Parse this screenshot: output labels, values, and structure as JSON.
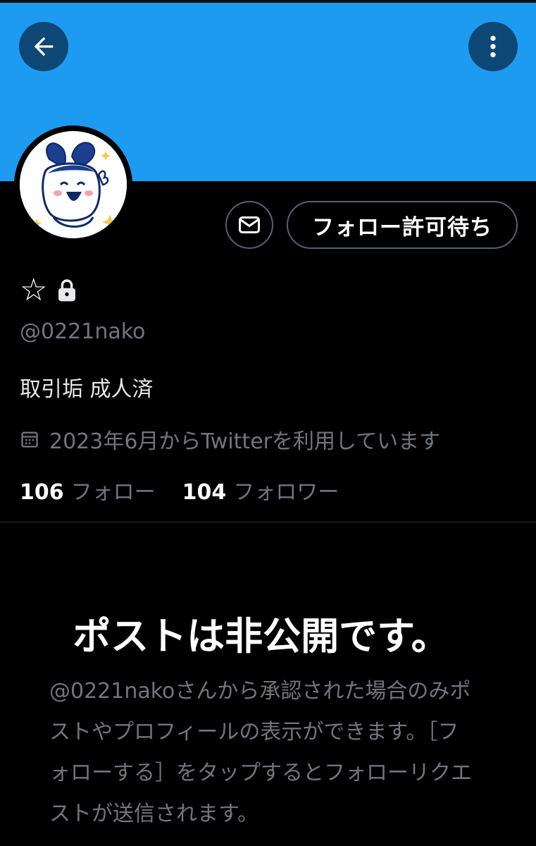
{
  "header": {
    "back_icon": "arrow-left-icon",
    "more_icon": "more-vertical-icon",
    "banner_color": "#1d9bf0"
  },
  "profile": {
    "name": "☆",
    "protected_icon": "lock-icon",
    "handle": "@0221nako",
    "bio": "取引垢 成人済",
    "joined_icon": "calendar-icon",
    "joined": "2023年6月からTwitterを利用しています",
    "following_count": "106",
    "following_label": "フォロー",
    "followers_count": "104",
    "followers_label": "フォロワー"
  },
  "actions": {
    "message_icon": "envelope-icon",
    "follow_label": "フォロー許可待ち"
  },
  "private_notice": {
    "title": "ポストは非公開です。",
    "body": "@0221nakoさんから承認された場合のみポストやプロフィールの表示ができます。［フォローする］をタップするとフォローリクエストが送信されます。"
  },
  "colors": {
    "accent": "#1d9bf0",
    "background": "#000000",
    "secondary_text": "#71767b",
    "border": "#536471"
  }
}
